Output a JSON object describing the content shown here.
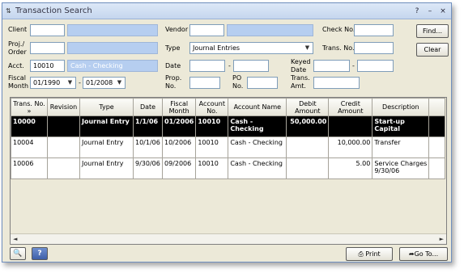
{
  "window": {
    "title": "Transaction Search",
    "menu_icon": "app-menu-icon",
    "help_btn": "?",
    "minimize_btn": "–",
    "close_btn": "×"
  },
  "filters": {
    "client_label": "Client",
    "client_code": "",
    "client_name": "",
    "vendor_label": "Vendor",
    "vendor_code": "",
    "vendor_name": "",
    "check_no_label": "Check No.",
    "check_no": "",
    "proj_order_label_1": "Proj./",
    "proj_order_label_2": "Order",
    "proj_order_code": "",
    "proj_order_name": "",
    "type_label": "Type",
    "type_value": "Journal Entries",
    "trans_no_label": "Trans. No.",
    "trans_no": "",
    "acct_label": "Acct.",
    "acct_code": "10010",
    "acct_name": "Cash - Checking",
    "date_label": "Date",
    "date_from": "",
    "date_dash": "-",
    "date_to": "",
    "keyed_date_label_1": "Keyed",
    "keyed_date_label_2": "Date",
    "keyed_from": "",
    "keyed_dash": "-",
    "keyed_to": "",
    "fiscal_label_1": "Fiscal",
    "fiscal_label_2": "Month",
    "fiscal_from": "01/1990",
    "fiscal_dash": "-",
    "fiscal_to": "01/2008",
    "prop_no_label_1": "Prop.",
    "prop_no_label_2": "No.",
    "prop_no": "",
    "po_no_label_1": "PO",
    "po_no_label_2": "No.",
    "po_no": "",
    "trans_amt_label_1": "Trans.",
    "trans_amt_label_2": "Amt.",
    "trans_amt": ""
  },
  "buttons": {
    "find": "Find...",
    "clear": "Clear",
    "print": "Print",
    "goto": "Go To..."
  },
  "grid": {
    "headers": [
      "Trans. No.",
      "Revision",
      "Type",
      "Date",
      "Fiscal Month",
      "Account No.",
      "Account Name",
      "Debit Amount",
      "Credit Amount",
      "Description"
    ],
    "rows": [
      {
        "trans_no": "10000",
        "revision": "",
        "type": "Journal Entry",
        "date": "1/1/06",
        "fiscal": "01/2006",
        "acct_no": "10010",
        "acct_name": "Cash - Checking",
        "debit": "50,000.00",
        "credit": "",
        "desc": "Start-up Capital"
      },
      {
        "trans_no": "10004",
        "revision": "",
        "type": "Journal Entry",
        "date": "10/1/06",
        "fiscal": "10/2006",
        "acct_no": "10010",
        "acct_name": "Cash - Checking",
        "debit": "",
        "credit": "10,000.00",
        "desc": "Transfer"
      },
      {
        "trans_no": "10006",
        "revision": "",
        "type": "Journal Entry",
        "date": "9/30/06",
        "fiscal": "09/2006",
        "acct_no": "10010",
        "acct_name": "Cash - Checking",
        "debit": "",
        "credit": "5.00",
        "desc": "Service Charges 9/30/06"
      }
    ],
    "sort_indicator": "»",
    "scroll_left": "◄",
    "scroll_right": "►"
  },
  "footer": {
    "search_icon": "magnifier-icon",
    "help_icon": "help-icon"
  },
  "colors": {
    "window_bg": "#ece9d8",
    "readonly_field": "#b6cef0",
    "selected_row": "#000000"
  }
}
